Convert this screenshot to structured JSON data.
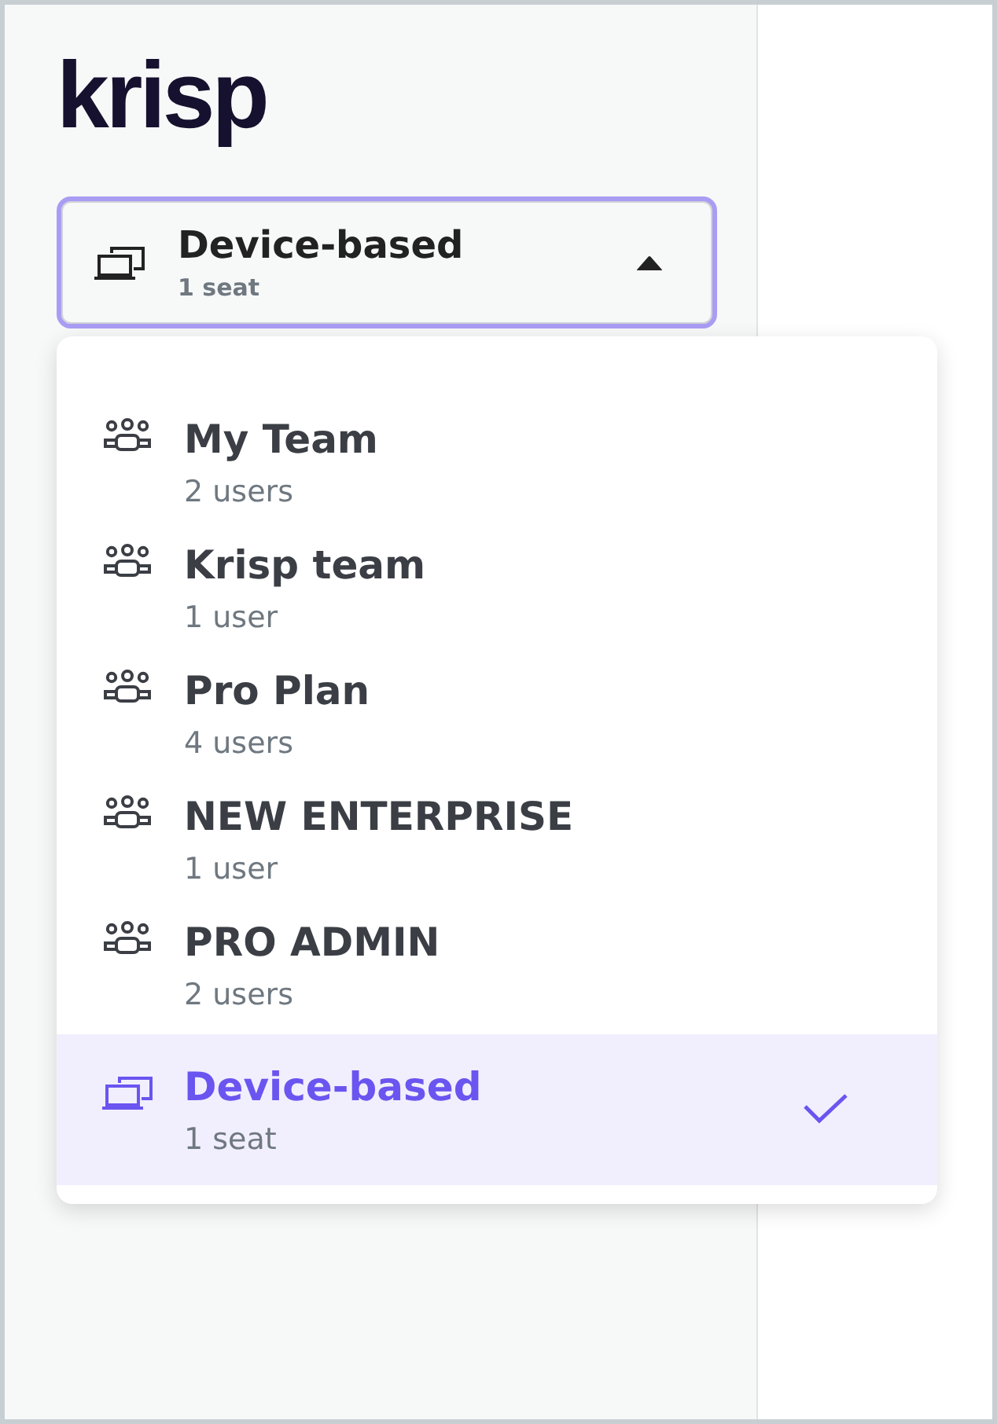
{
  "logo": "krisp",
  "selector": {
    "kind": "device",
    "title": "Device-based",
    "subtitle": "1 seat",
    "expanded": true
  },
  "menu": {
    "items": [
      {
        "kind": "team",
        "title": "My Team",
        "subtitle": "2 users",
        "selected": false
      },
      {
        "kind": "team",
        "title": "Krisp team",
        "subtitle": "1 user",
        "selected": false
      },
      {
        "kind": "team",
        "title": "Pro Plan",
        "subtitle": "4 users",
        "selected": false
      },
      {
        "kind": "team",
        "title": "NEW ENTERPRISE",
        "subtitle": "1 user",
        "selected": false
      },
      {
        "kind": "team",
        "title": "PRO ADMIN",
        "subtitle": "2 users",
        "selected": false
      },
      {
        "kind": "device",
        "title": "Device-based",
        "subtitle": "1 seat",
        "selected": true
      }
    ]
  }
}
